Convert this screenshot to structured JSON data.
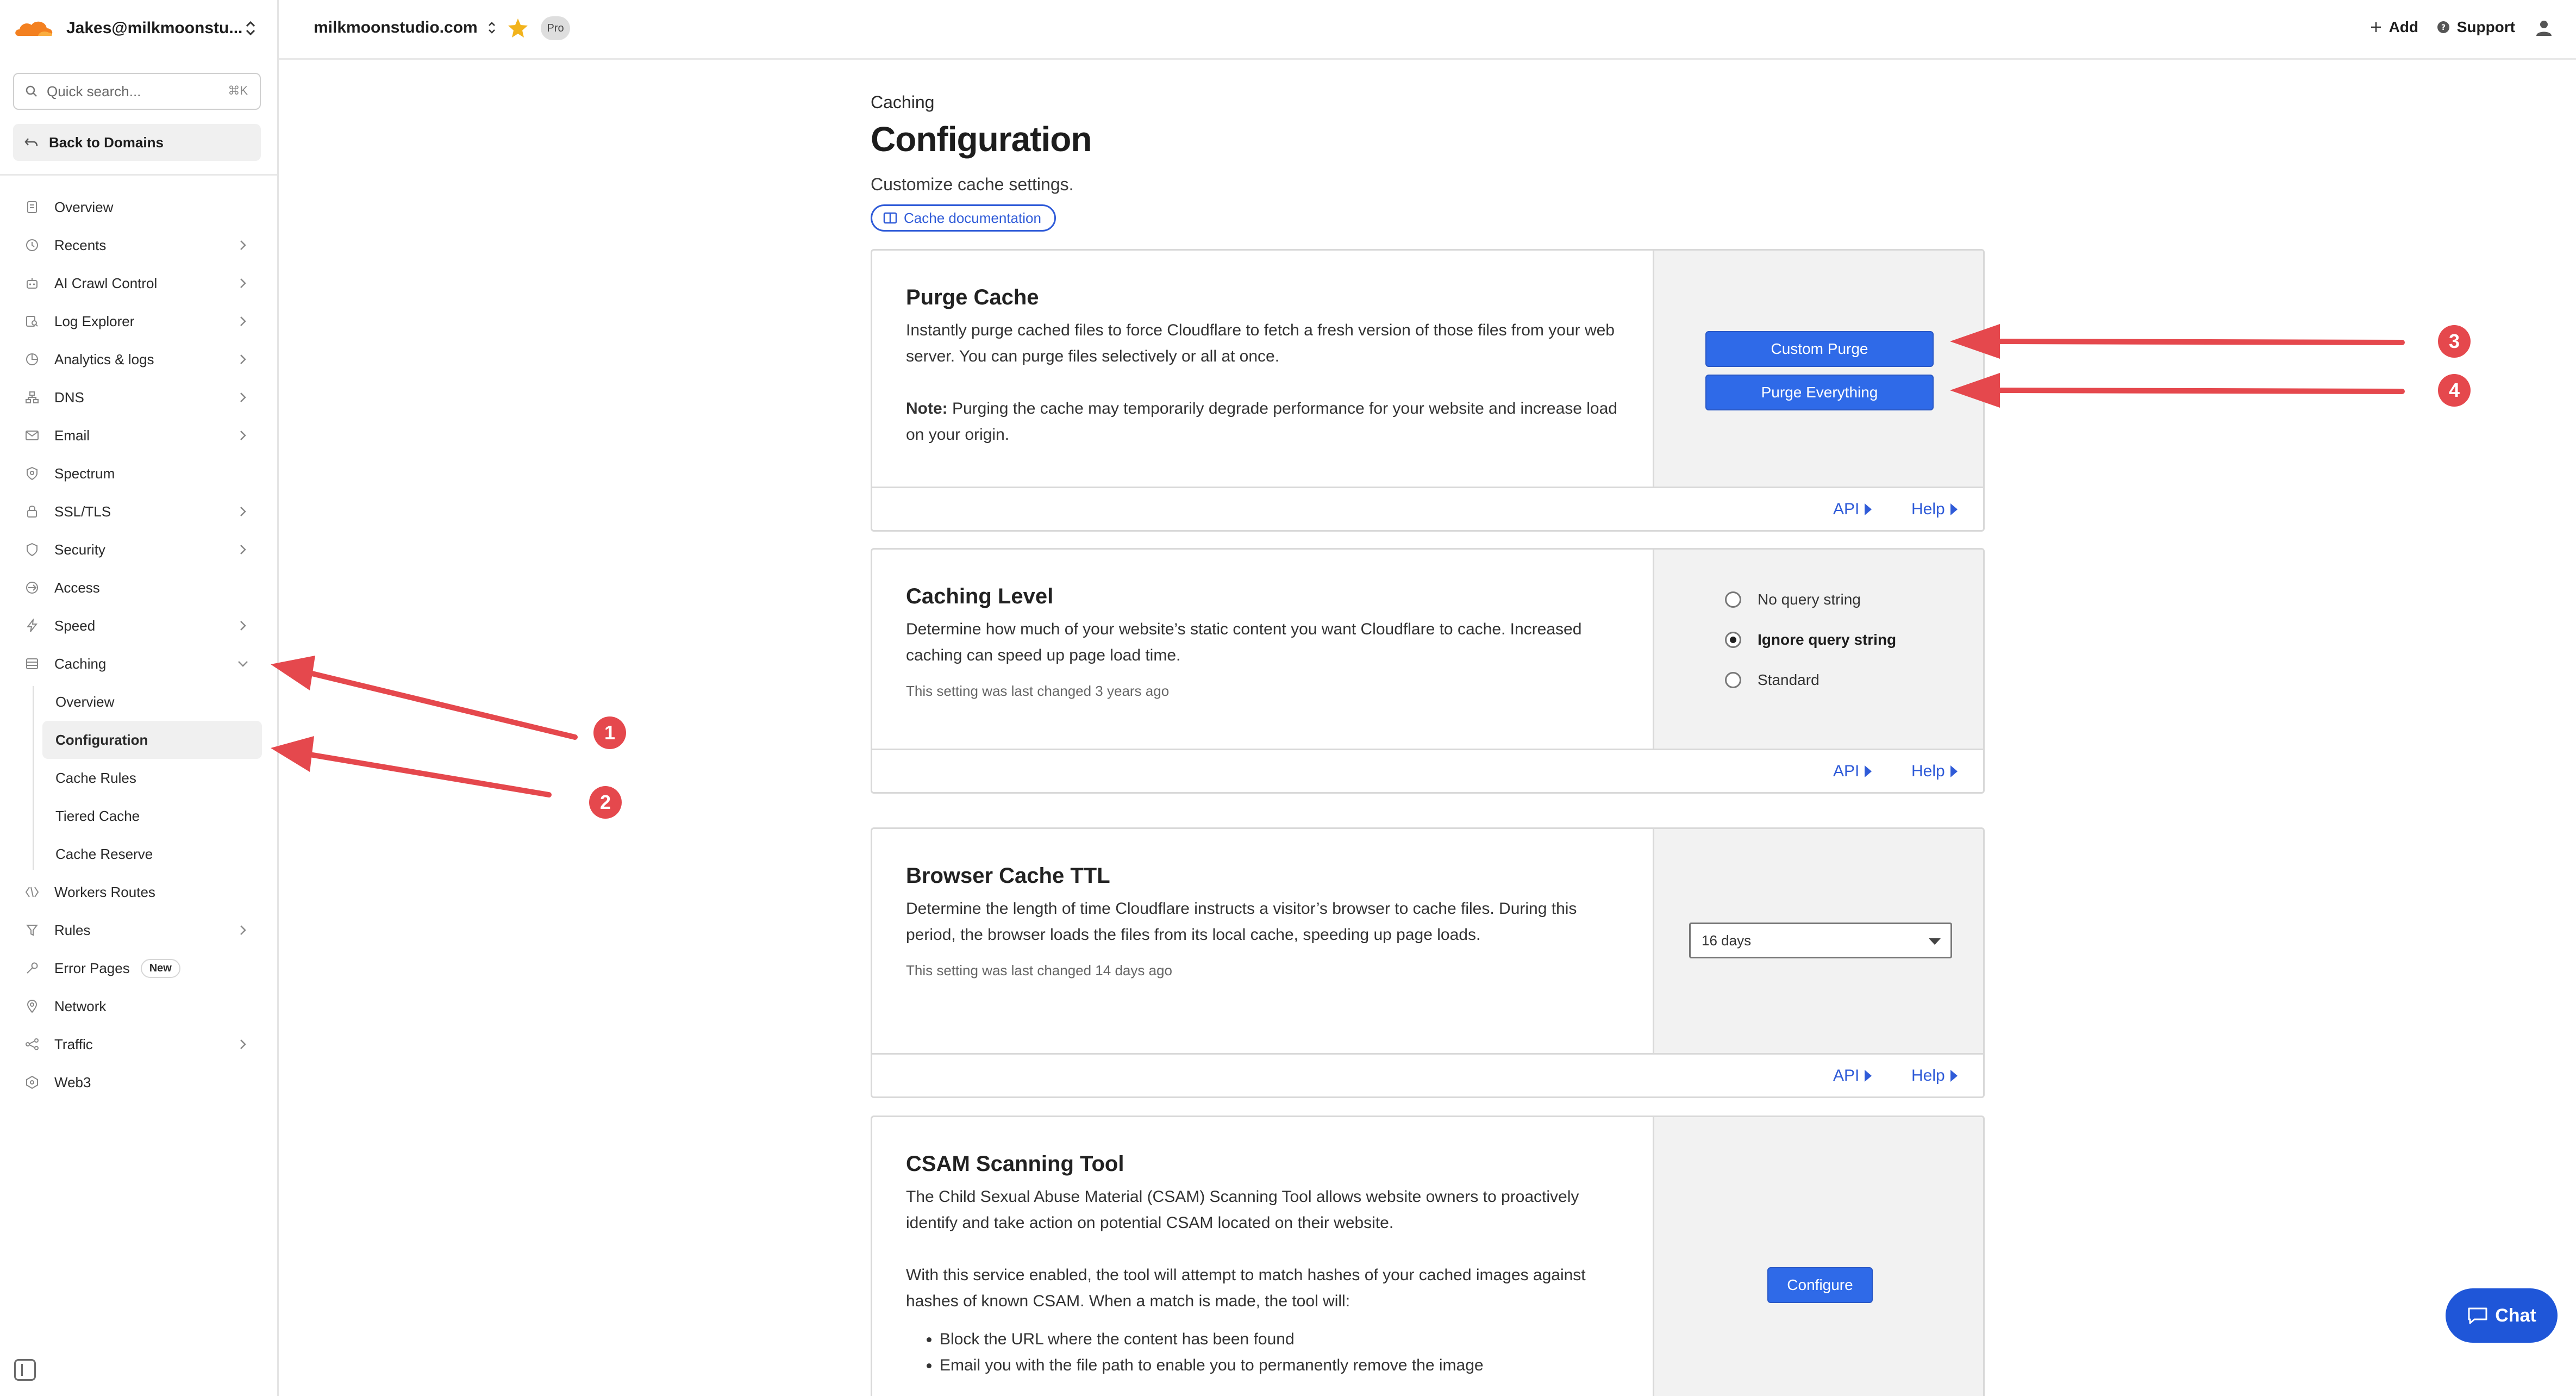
{
  "account": {
    "name": "Jakes@milkmoonstu..."
  },
  "search": {
    "placeholder": "Quick search...",
    "shortcut": "⌘K"
  },
  "back": {
    "label": "Back to Domains"
  },
  "nav": {
    "items": [
      {
        "label": "Overview",
        "icon": "document-icon",
        "arrow": false
      },
      {
        "label": "Recents",
        "icon": "clock-icon",
        "arrow": true
      },
      {
        "label": "AI Crawl Control",
        "icon": "bot-icon",
        "arrow": true
      },
      {
        "label": "Log Explorer",
        "icon": "search-log-icon",
        "arrow": true
      },
      {
        "label": "Analytics & logs",
        "icon": "chart-icon",
        "arrow": true
      },
      {
        "label": "DNS",
        "icon": "network-icon",
        "arrow": true
      },
      {
        "label": "Email",
        "icon": "envelope-icon",
        "arrow": true
      },
      {
        "label": "Spectrum",
        "icon": "spectrum-icon",
        "arrow": false
      },
      {
        "label": "SSL/TLS",
        "icon": "lock-icon",
        "arrow": true
      },
      {
        "label": "Security",
        "icon": "shield-icon",
        "arrow": true
      },
      {
        "label": "Access",
        "icon": "access-icon",
        "arrow": false
      },
      {
        "label": "Speed",
        "icon": "bolt-icon",
        "arrow": true
      },
      {
        "label": "Caching",
        "icon": "caching-icon",
        "arrow": "down"
      }
    ],
    "caching_sub": [
      "Overview",
      "Configuration",
      "Cache Rules",
      "Tiered Cache",
      "Cache Reserve"
    ],
    "items_after": [
      {
        "label": "Workers Routes",
        "icon": "workers-icon",
        "arrow": false
      },
      {
        "label": "Rules",
        "icon": "rules-icon",
        "arrow": true
      },
      {
        "label": "Error Pages",
        "icon": "wrench-icon",
        "arrow": false,
        "badge": "New"
      },
      {
        "label": "Network",
        "icon": "pin-icon",
        "arrow": false
      },
      {
        "label": "Traffic",
        "icon": "traffic-icon",
        "arrow": true
      },
      {
        "label": "Web3",
        "icon": "web3-icon",
        "arrow": false
      }
    ]
  },
  "topbar": {
    "domain": "milkmoonstudio.com",
    "plan": "Pro",
    "add": "Add",
    "support": "Support"
  },
  "page": {
    "breadcrumb": "Caching",
    "title": "Configuration",
    "subtitle": "Customize cache settings.",
    "doc_link": "Cache documentation"
  },
  "cards": {
    "purge": {
      "title": "Purge Cache",
      "desc": "Instantly purge cached files to force Cloudflare to fetch a fresh version of those files from your web server. You can purge files selectively or all at once.",
      "note_label": "Note:",
      "note": " Purging the cache may temporarily degrade performance for your website and increase load on your origin.",
      "btn_custom": "Custom Purge",
      "btn_all": "Purge Everything",
      "api": "API",
      "help": "Help"
    },
    "level": {
      "title": "Caching Level",
      "desc": "Determine how much of your website’s static content you want Cloudflare to cache. Increased caching can speed up page load time.",
      "changed": "This setting was last changed 3 years ago",
      "options": [
        "No query string",
        "Ignore query string",
        "Standard"
      ],
      "selected": 1,
      "api": "API",
      "help": "Help"
    },
    "ttl": {
      "title": "Browser Cache TTL",
      "desc": "Determine the length of time Cloudflare instructs a visitor’s browser to cache files. During this period, the browser loads the files from its local cache, speeding up page loads.",
      "changed": "This setting was last changed 14 days ago",
      "value": "16 days",
      "api": "API",
      "help": "Help"
    },
    "csam": {
      "title": "CSAM Scanning Tool",
      "desc1": "The Child Sexual Abuse Material (CSAM) Scanning Tool allows website owners to proactively identify and take action on potential CSAM located on their website.",
      "desc2": "With this service enabled, the tool will attempt to match hashes of your cached images against hashes of known CSAM. When a match is made, the tool will:",
      "bullets": [
        "Block the URL where the content has been found",
        "Email you with the file path to enable you to permanently remove the image"
      ],
      "btn": "Configure"
    }
  },
  "chat": {
    "label": "Chat"
  },
  "annotations": [
    "1",
    "2",
    "3",
    "4"
  ],
  "colors": {
    "accent": "#2f6ae8",
    "link": "#2f5bd8",
    "annotation": "#e5484d",
    "cloudflare_orange": "#f38020"
  }
}
